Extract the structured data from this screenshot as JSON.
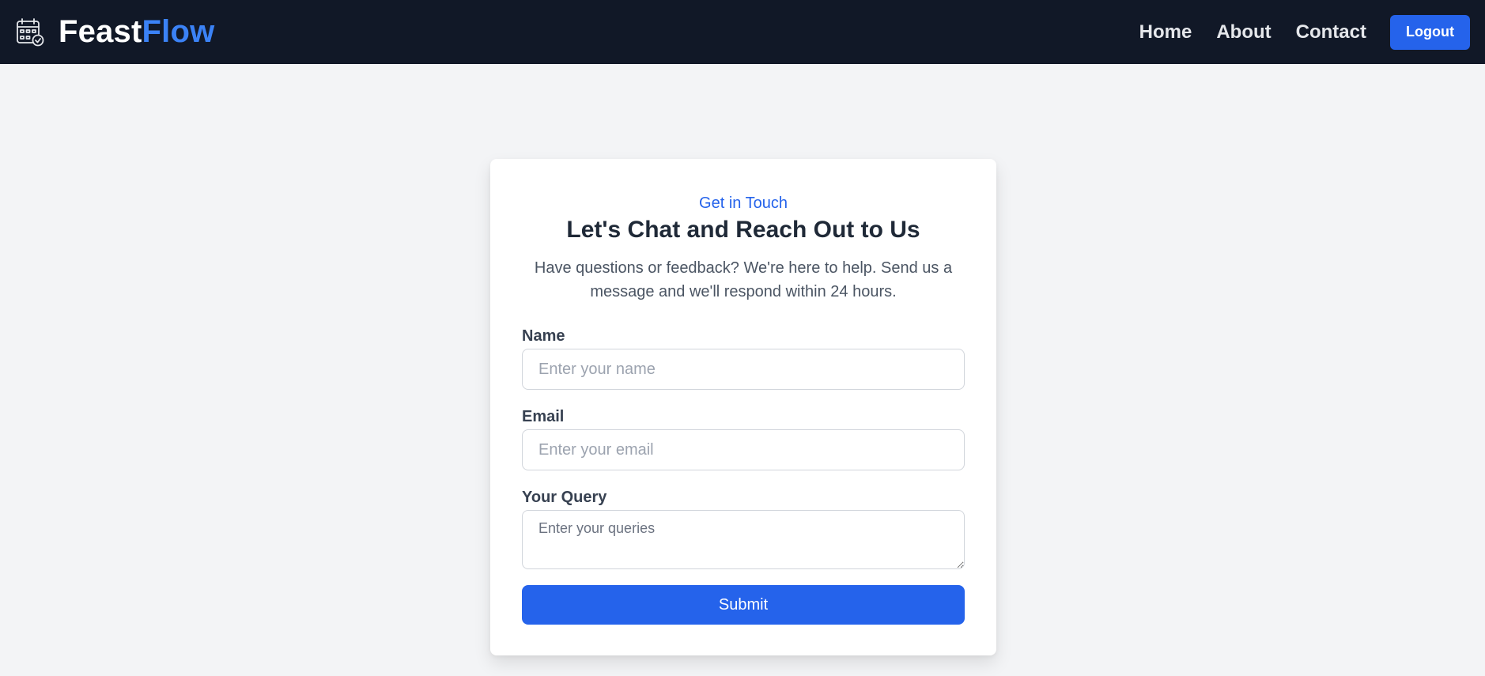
{
  "brand": {
    "part1": "Feast",
    "part2": "Flow",
    "icon": "calendar-check-icon",
    "accent_color": "#3b82f6"
  },
  "nav": {
    "links": [
      "Home",
      "About",
      "Contact"
    ],
    "logout_label": "Logout"
  },
  "contact": {
    "eyebrow": "Get in Touch",
    "title": "Let's Chat and Reach Out to Us",
    "description": "Have questions or feedback? We're here to help. Send us a message and we'll respond within 24 hours.",
    "fields": {
      "name": {
        "label": "Name",
        "placeholder": "Enter your name",
        "value": ""
      },
      "email": {
        "label": "Email",
        "placeholder": "Enter your email",
        "value": ""
      },
      "query": {
        "label": "Your Query",
        "placeholder": "Enter your queries",
        "value": ""
      }
    },
    "submit_label": "Submit"
  },
  "colors": {
    "navbar_bg": "#111827",
    "primary": "#2563eb",
    "page_bg": "#f3f4f6"
  }
}
